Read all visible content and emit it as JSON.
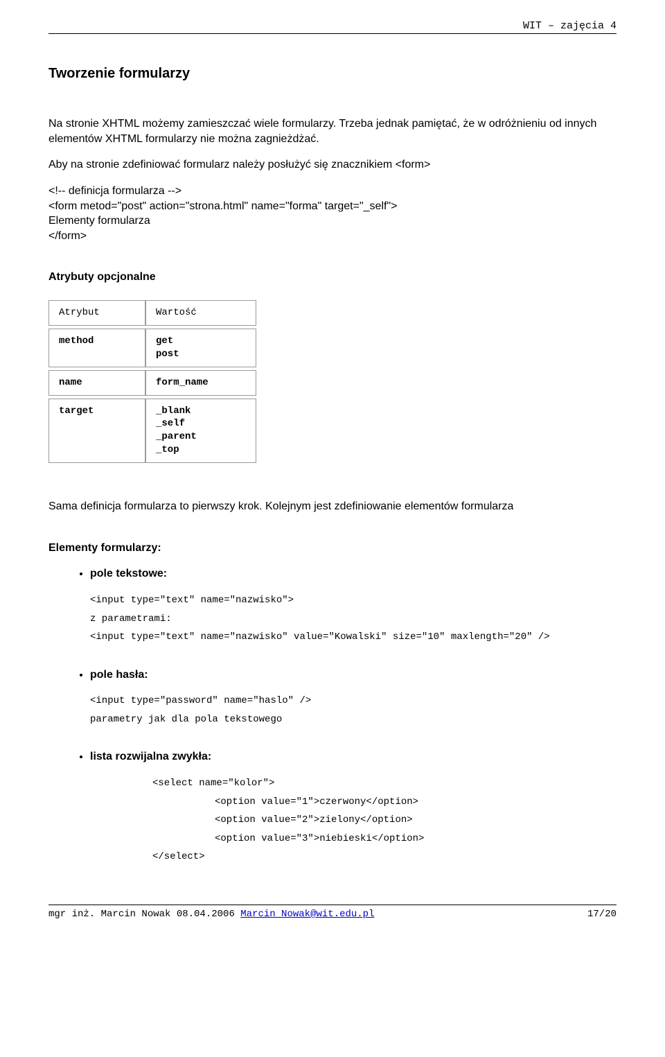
{
  "header": {
    "text": "WIT – zajęcia 4"
  },
  "title": "Tworzenie formularzy",
  "intro1": "Na stronie XHTML możemy zamieszczać wiele formularzy. Trzeba jednak pamiętać, że w odróżnieniu od innych elementów XHTML formularzy nie można zagnieżdżać.",
  "intro2": "Aby na stronie zdefiniować formularz należy posłużyć się znacznikiem <form>",
  "form_def": {
    "comment": "<!-- definicja formularza -->",
    "open": "<form metod=\"post\" action=\"strona.html\" name=\"forma\" target=\"_self\">",
    "inner": "Elementy formularza",
    "close": "</form>"
  },
  "attr_heading": "Atrybuty opcjonalne",
  "attr_table": {
    "head": {
      "c1": "Atrybut",
      "c2": "Wartość"
    },
    "rows": [
      {
        "c1": "method",
        "c2": [
          "get",
          "post"
        ]
      },
      {
        "c1": "name",
        "c2": [
          "form_name"
        ]
      },
      {
        "c1": "target",
        "c2": [
          "_blank",
          "_self",
          "_parent",
          "_top"
        ]
      }
    ]
  },
  "mid_text": "Sama definicja formularza to pierwszy krok. Kolejnym jest zdefiniowanie elementów formularza",
  "elems_heading": "Elementy formularzy:",
  "field_text": {
    "title": "pole tekstowe:",
    "l1": "<input type=\"text\" name=\"nazwisko\">",
    "l2": "z parametrami:",
    "l3": "<input type=\"text\" name=\"nazwisko\" value=\"Kowalski\" size=\"10\" maxlength=\"20\" />"
  },
  "field_pass": {
    "title": "pole hasła:",
    "l1": "<input type=\"password\" name=\"haslo\" />",
    "l2": "parametry jak dla pola tekstowego"
  },
  "field_select": {
    "title": "lista rozwijalna zwykła:",
    "l1": "<select name=\"kolor\">",
    "o1": "<option value=\"1\">czerwony</option>",
    "o2": "<option value=\"2\">zielony</option>",
    "o3": "<option value=\"3\">niebieski</option>",
    "close": "</select>"
  },
  "footer": {
    "left_pre": "mgr inż. Marcin Nowak 08.04.2006 ",
    "email": "Marcin_Nowak@wit.edu.pl",
    "page": "17/20"
  }
}
